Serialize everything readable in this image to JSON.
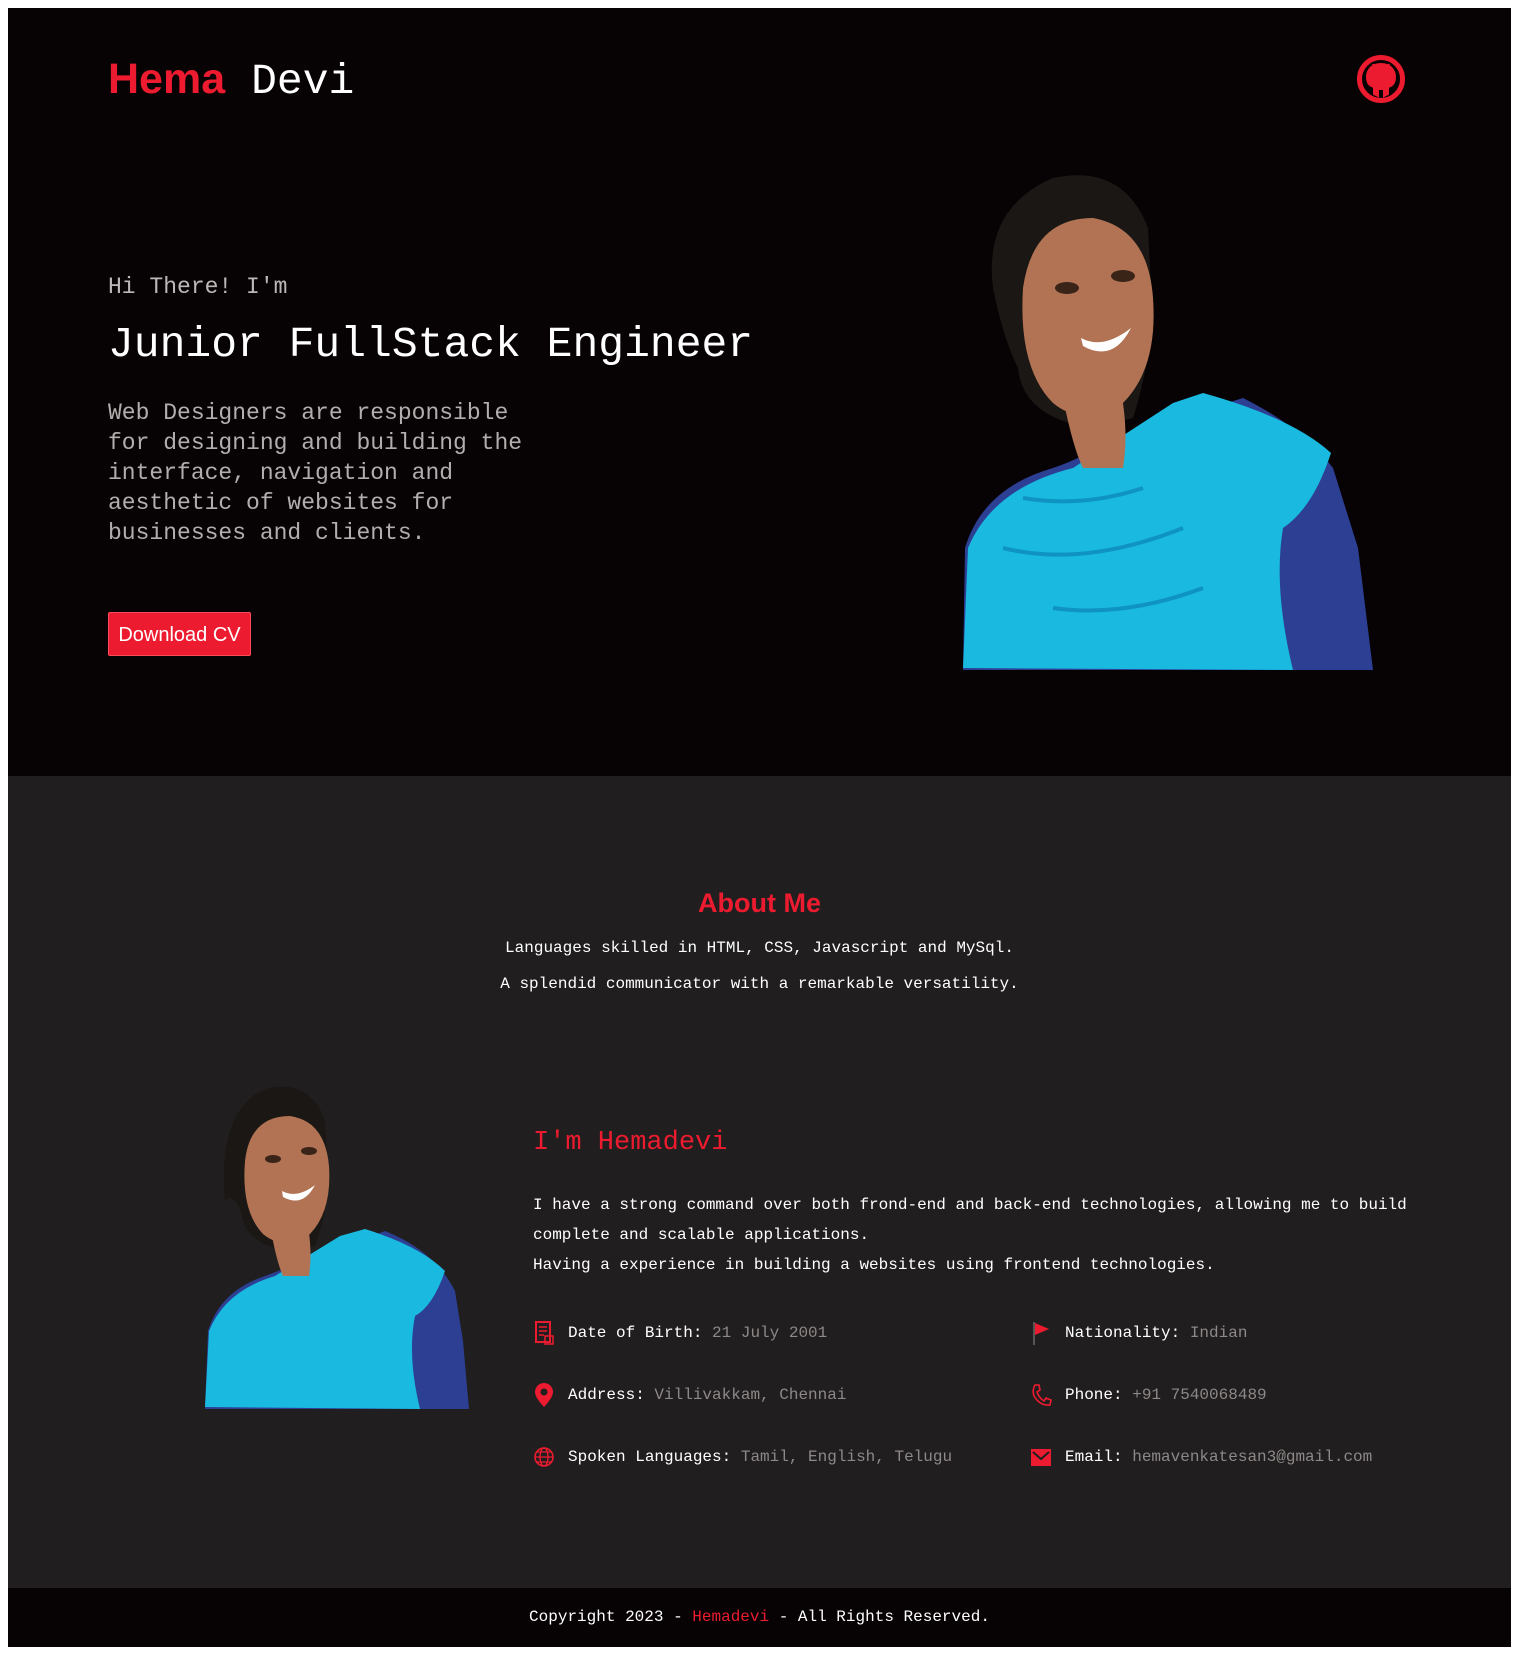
{
  "header": {
    "brand_first": "Hema",
    "brand_last": "Devi"
  },
  "hero": {
    "greeting": "Hi There! I'm",
    "role": "Junior FullStack Engineer",
    "description": "Web Designers are responsible for designing and building the interface, navigation and aesthetic of websites for businesses and clients.",
    "cta_label": "Download CV"
  },
  "about": {
    "title": "About Me",
    "line1": "Languages skilled in HTML, CSS, Javascript and MySql.",
    "line2": "A splendid communicator with a remarkable versatility.",
    "heading": "I'm Hemadevi",
    "bio1": "I have a strong command over both frond-end and back-end technologies, allowing me to build complete and scalable applications.",
    "bio2": "Having a experience in building a websites using frontend technologies.",
    "info": {
      "dob_label": "Date of Birth:",
      "dob_value": "21 July 2001",
      "nationality_label": "Nationality:",
      "nationality_value": "Indian",
      "address_label": "Address:",
      "address_value": "Villivakkam, Chennai",
      "phone_label": "Phone:",
      "phone_value": "+91 7540068489",
      "languages_label": "Spoken Languages:",
      "languages_value": "Tamil, English, Telugu",
      "email_label": "Email:",
      "email_value": "hemavenkatesan3@gmail.com"
    }
  },
  "footer": {
    "prefix": "Copyright 2023 - ",
    "name": "Hemadevi",
    "suffix": " - All Rights Reserved."
  },
  "colors": {
    "accent": "#ed1b2f",
    "hero_bg": "#070304",
    "about_bg": "#201e1e",
    "muted": "#8e8888"
  },
  "icons": [
    "github-icon",
    "calendar-icon",
    "flag-icon",
    "location-pin-icon",
    "phone-icon",
    "globe-icon",
    "email-icon"
  ]
}
